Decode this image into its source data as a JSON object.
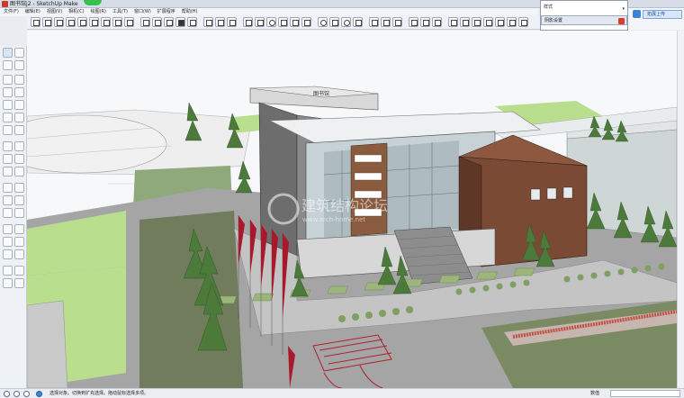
{
  "window": {
    "title": "图书馆j2 - SketchUp Make"
  },
  "menu": {
    "items": [
      "文件(F)",
      "编辑(E)",
      "视图(V)",
      "相机(C)",
      "绘图(R)",
      "工具(T)",
      "窗口(W)",
      "扩展程序",
      "帮助(H)"
    ]
  },
  "tray": {
    "styles_label": "样式",
    "shadow_label": "阴影设置"
  },
  "upload": {
    "label": "拓展上传"
  },
  "model": {
    "building_sign": "图书馆",
    "watermark_cn": "建筑结构论坛",
    "watermark_en": "www.arch-home.net"
  },
  "status": {
    "hint": "选择对象。切换到扩充选择。拖动鼠标选择多项。",
    "vcb_label": "数值",
    "vcb_value": ""
  },
  "icons": {
    "toolbar": [
      "select-icon",
      "component-icon",
      "paint-icon",
      "eraser-icon",
      "rectangle-icon",
      "line-icon",
      "circle-icon",
      "arc-icon",
      "polygon-icon",
      "freehand-icon",
      "move-icon",
      "pushpull-icon",
      "rotate-icon",
      "followme-icon",
      "scale-icon",
      "offset-icon",
      "tape-icon",
      "dimension-icon",
      "protractor-icon",
      "text-icon",
      "axes-icon",
      "3dtext-icon",
      "orbit-icon",
      "pan-icon",
      "zoom-icon",
      "zoom-window-icon",
      "zoom-extents-icon",
      "previous-icon",
      "position-camera-icon",
      "walk-icon",
      "lookaround-icon",
      "section-icon"
    ]
  },
  "colors": {
    "accent": "#3b84d8",
    "grass": "#b9de8e",
    "facade_brown": "#7a4a35"
  }
}
